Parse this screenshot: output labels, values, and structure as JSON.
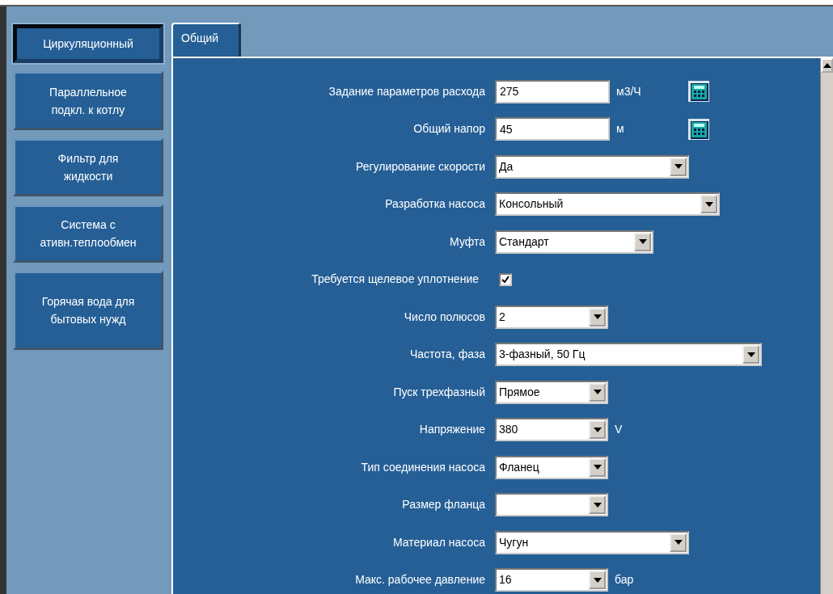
{
  "sidebar": {
    "items": [
      {
        "label": "Циркуляционный",
        "selected": true
      },
      {
        "label": "Параллельное\nподкл. к котлу",
        "selected": false
      },
      {
        "label": "Фильтр для\nжидкости",
        "selected": false
      },
      {
        "label": "Система с\nативн.теплообмен",
        "selected": false
      },
      {
        "label": "Горячая вода для\nбытовых нужд",
        "selected": false
      }
    ]
  },
  "tabs": [
    {
      "label": "Общий",
      "selected": true
    }
  ],
  "form": {
    "rows": [
      {
        "kind": "input",
        "label": "Задание параметров расхода",
        "value": "275",
        "unit": "м3/Ч",
        "calculator": true
      },
      {
        "kind": "input",
        "label": "Общий напор",
        "value": "45",
        "unit": "м",
        "calculator": true
      },
      {
        "kind": "select",
        "label": "Регулирование скорости",
        "value": "Да"
      },
      {
        "kind": "select",
        "label": "Разработка насоса",
        "value": "Консольный"
      },
      {
        "kind": "select",
        "label": "Муфта",
        "value": "Стандарт"
      },
      {
        "kind": "checkbox",
        "label": "Требуется щелевое уплотнение",
        "checked": true
      },
      {
        "kind": "select",
        "label": "Число полюсов",
        "value": "2"
      },
      {
        "kind": "select",
        "label": "Частота, фаза",
        "value": "3-фазный, 50 Гц"
      },
      {
        "kind": "select",
        "label": "Пуск трехфазный",
        "value": "Прямое"
      },
      {
        "kind": "select",
        "label": "Напряжение",
        "value": "380",
        "unit": "V"
      },
      {
        "kind": "select",
        "label": "Тип соединения насоса",
        "value": "Фланец"
      },
      {
        "kind": "select",
        "label": "Размер фланца"
      },
      {
        "kind": "select",
        "label": "Материал насоса",
        "value": "Чугун"
      },
      {
        "kind": "select",
        "label": "Макс. рабочее давление",
        "value": "16",
        "unit": "бар"
      }
    ]
  }
}
